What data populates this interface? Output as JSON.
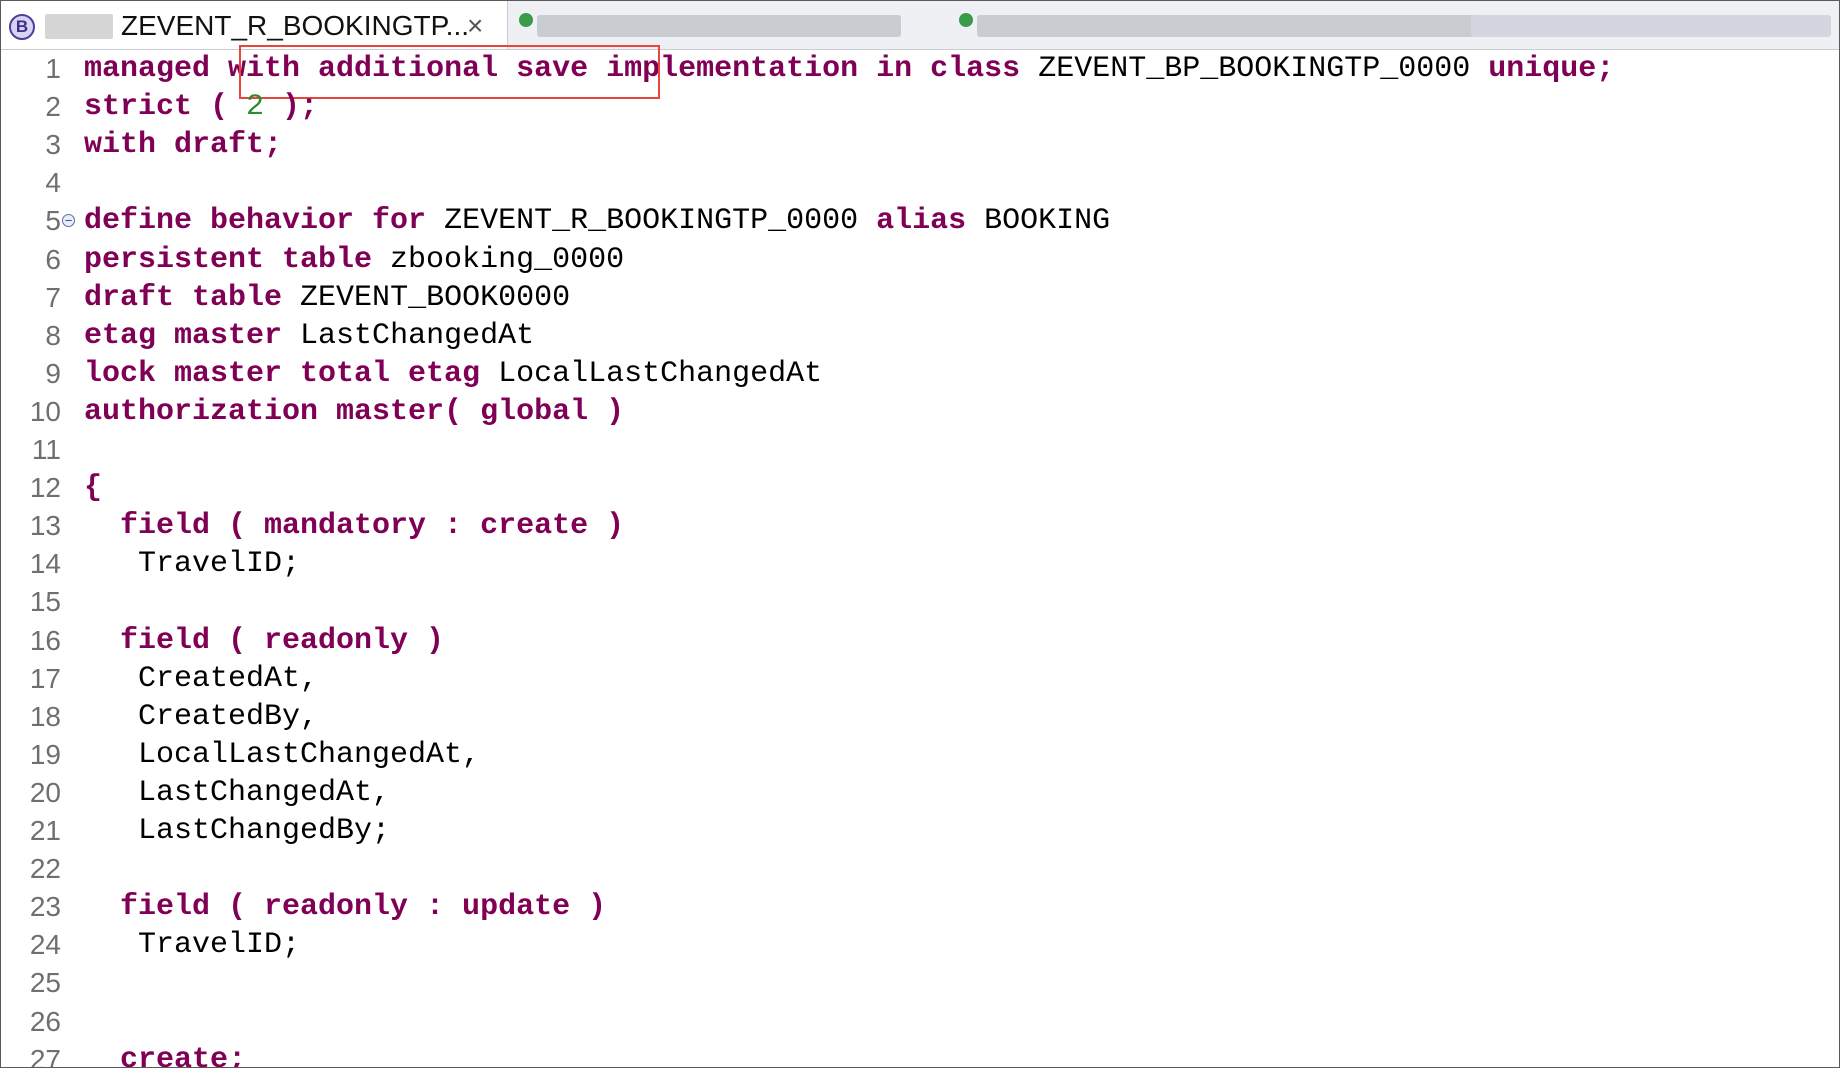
{
  "tabs": {
    "active": {
      "icon": "bdef-b-icon",
      "title": "ZEVENT_R_BOOKINGTP...",
      "close_glyph": "×"
    }
  },
  "editor": {
    "lines": [
      {
        "n": "1",
        "segs": [
          [
            "kw",
            "managed "
          ],
          [
            "kw",
            "with additional save"
          ],
          [
            "",
            " "
          ],
          [
            "kw",
            "implementation in class"
          ],
          [
            "",
            " ZEVENT_BP_BOOKINGTP_0000 "
          ],
          [
            "kw",
            "unique;"
          ]
        ]
      },
      {
        "n": "2",
        "segs": [
          [
            "kw",
            "strict ( "
          ],
          [
            "num",
            "2"
          ],
          [
            "kw",
            " );"
          ]
        ]
      },
      {
        "n": "3",
        "segs": [
          [
            "kw",
            "with draft;"
          ]
        ]
      },
      {
        "n": "4",
        "segs": []
      },
      {
        "n": "5",
        "segs": [
          [
            "kw",
            "define behavior for"
          ],
          [
            "",
            " ZEVENT_R_BOOKINGTP_0000 "
          ],
          [
            "kw",
            "alias"
          ],
          [
            "",
            " BOOKING"
          ]
        ]
      },
      {
        "n": "6",
        "segs": [
          [
            "kw",
            "persistent table"
          ],
          [
            "",
            " zbooking_0000"
          ]
        ]
      },
      {
        "n": "7",
        "segs": [
          [
            "kw",
            "draft table"
          ],
          [
            "",
            " ZEVENT_BOOK0000"
          ]
        ]
      },
      {
        "n": "8",
        "segs": [
          [
            "kw",
            "etag master"
          ],
          [
            "",
            " LastChangedAt"
          ]
        ]
      },
      {
        "n": "9",
        "segs": [
          [
            "kw",
            "lock master total etag"
          ],
          [
            "",
            " LocalLastChangedAt"
          ]
        ]
      },
      {
        "n": "10",
        "segs": [
          [
            "kw",
            "authorization master( global )"
          ]
        ]
      },
      {
        "n": "11",
        "segs": []
      },
      {
        "n": "12",
        "segs": [
          [
            "kw",
            "{"
          ]
        ]
      },
      {
        "n": "13",
        "segs": [
          [
            "kw",
            "  field ( mandatory : create )"
          ]
        ]
      },
      {
        "n": "14",
        "segs": [
          [
            "",
            "   TravelID;"
          ]
        ]
      },
      {
        "n": "15",
        "segs": []
      },
      {
        "n": "16",
        "segs": [
          [
            "kw",
            "  field ( readonly )"
          ]
        ]
      },
      {
        "n": "17",
        "segs": [
          [
            "",
            "   CreatedAt,"
          ]
        ]
      },
      {
        "n": "18",
        "segs": [
          [
            "",
            "   CreatedBy,"
          ]
        ]
      },
      {
        "n": "19",
        "segs": [
          [
            "",
            "   LocalLastChangedAt,"
          ]
        ]
      },
      {
        "n": "20",
        "segs": [
          [
            "",
            "   LastChangedAt,"
          ]
        ]
      },
      {
        "n": "21",
        "segs": [
          [
            "",
            "   LastChangedBy;"
          ]
        ]
      },
      {
        "n": "22",
        "segs": []
      },
      {
        "n": "23",
        "segs": [
          [
            "kw",
            "  field ( readonly : update )"
          ]
        ]
      },
      {
        "n": "24",
        "segs": [
          [
            "",
            "   TravelID;"
          ]
        ]
      },
      {
        "n": "25",
        "segs": []
      },
      {
        "n": "26",
        "segs": []
      },
      {
        "n": "27",
        "segs": [
          [
            "kw",
            "  create;"
          ]
        ]
      }
    ],
    "fold_marker_line": "5",
    "fold_glyph": "−",
    "highlight_line": "1",
    "colors": {
      "keyword": "#7f0055",
      "number": "#2e8b2e",
      "identifier": "#000000",
      "line_number": "#6f6f6f",
      "highlight_box": "#e8453c"
    }
  }
}
